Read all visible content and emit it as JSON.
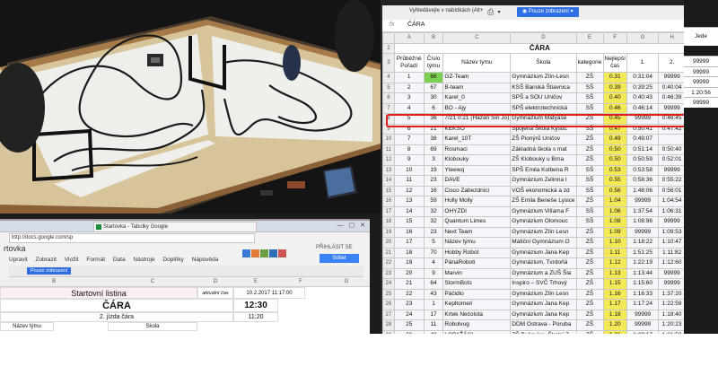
{
  "monitor": {
    "toolbar": {
      "label": "Vyhledávejte v nabídkách (Alt+",
      "view_button": "Pouze zobrazení",
      "icons": [
        "print-icon",
        "filter-icon"
      ]
    },
    "formula_bar": {
      "label": "fx",
      "value": "ČÁRA"
    },
    "column_headers": [
      "A",
      "B",
      "C",
      "D",
      "E",
      "F",
      "G",
      "H"
    ],
    "merged_title": "ČÁRA",
    "header_row": {
      "row": "3",
      "cells": [
        "Průběžné Pořadí",
        "Číslo týmu",
        "Název týmu",
        "Škola",
        "kategorie",
        "Nejlepší čas",
        "1.",
        "2."
      ]
    },
    "rows": [
      [
        "4",
        "1",
        "66",
        "GZ-Team",
        "Gymnázium Zlín-Lesn",
        "ZŠ",
        "0.31",
        "0:31:04",
        "99999"
      ],
      [
        "5",
        "2",
        "67",
        "B-team",
        "KSŠ Banská Štiavnica",
        "SŠ",
        "0.39",
        "0:39:25",
        "0:40:04"
      ],
      [
        "6",
        "3",
        "30",
        "Karel_0",
        "SPŠ a SOU Uničov",
        "SŠ",
        "0.40",
        "0:40:43",
        "0:46:39"
      ],
      [
        "7",
        "4",
        "6",
        "BO - Ajy",
        "SPŠ elektrotechnická",
        "SŠ",
        "0.46",
        "0:46:14",
        "99999"
      ],
      [
        "8",
        "5",
        "36",
        "7/21 0:21 (Hazan Sin Jo)",
        "Gymnázium Matyáše",
        "ZŠ",
        "0.45",
        "99999",
        "0:46:45"
      ],
      [
        "9",
        "6",
        "21",
        "KEKSO",
        "Spojená Škola Kysuc",
        "SŠ",
        "0.47",
        "0:50:41",
        "0:47:42"
      ],
      [
        "10",
        "7",
        "38",
        "Karel_10T",
        "ZŠ Pionýrů Uničov",
        "ZŠ",
        "0.49",
        "0:49:07",
        ""
      ],
      [
        "11",
        "8",
        "69",
        "Rosmaci",
        "Základná škola s mat",
        "ZŠ",
        "0.50",
        "0:51:14",
        "0:50:40"
      ],
      [
        "12",
        "9",
        "3",
        "Klobouky",
        "ZŠ Klobouky u Brna",
        "ZŠ",
        "0.50",
        "0:50:59",
        "0:52:01"
      ],
      [
        "13",
        "10",
        "19",
        "Yteewq",
        "SPŠ Emila Kolbena R",
        "SŠ",
        "0.53",
        "0:53:58",
        "99999"
      ],
      [
        "14",
        "11",
        "23",
        "DAVE",
        "Gymnázium Zelinna I",
        "SŠ",
        "0.55",
        "0:58:36",
        "0:55:22"
      ],
      [
        "15",
        "12",
        "16",
        "Cisco Zabezdnici",
        "VOŠ ekonomická a zd",
        "SŠ",
        "0.56",
        "1:48:06",
        "0:56:01"
      ],
      [
        "16",
        "13",
        "59",
        "Holly Molly",
        "ZŠ Emila Beneše Lysice",
        "ZŠ",
        "1.04",
        "99999",
        "1:04:54"
      ],
      [
        "17",
        "14",
        "32",
        "OHYZDI",
        "Gymnázium Vilíama F",
        "SŠ",
        "1.06",
        "1:37:54",
        "1:06:31"
      ],
      [
        "18",
        "15",
        "32",
        "Quantum Limes",
        "Gymnázium Olomouc",
        "SŠ",
        "1.08",
        "1:08:96",
        "99999"
      ],
      [
        "19",
        "16",
        "23",
        "Next Team",
        "Gymnázium Zlín Lesn",
        "ZŠ",
        "1.09",
        "99999",
        "1:09:53"
      ],
      [
        "20",
        "17",
        "5",
        "Název týmu",
        "Matiční Gymnázium O",
        "ZŠ",
        "1.10",
        "1:18:22",
        "1:10:47"
      ],
      [
        "21",
        "18",
        "70",
        "Hobby Robot",
        "Gymnázium Jana Kep",
        "ZŠ",
        "1.11",
        "1:51:25",
        "1:11:82"
      ],
      [
        "22",
        "19",
        "4",
        "PánaRoboti",
        "Gymnázium, Tvrdoňá",
        "ZŠ",
        "1.12",
        "1:22:19",
        "1:12:60"
      ],
      [
        "23",
        "20",
        "9",
        "Marvin",
        "Gymnázium a ZUŠ Šla",
        "ZŠ",
        "1.13",
        "1:13:44",
        "99999"
      ],
      [
        "24",
        "21",
        "64",
        "StormBots",
        "Inspiro – SVČ Trhový",
        "ZŠ",
        "1.15",
        "1:15:60",
        "99999"
      ],
      [
        "25",
        "22",
        "43",
        "Páčidlo",
        "Gymnázium Zlín Lesn",
        "ZŠ",
        "1.16",
        "1:16:33",
        "1:37:20"
      ],
      [
        "26",
        "23",
        "1",
        "Kepltomeri",
        "Gymnázium Jana Kep",
        "ZŠ",
        "1.17",
        "1:17:24",
        "1:22:59"
      ],
      [
        "27",
        "24",
        "17",
        "Krtek Nečolota",
        "Gymnázium Jana Kep",
        "ZŠ",
        "1.18",
        "99999",
        "1:18:40"
      ],
      [
        "28",
        "25",
        "11",
        "Robolvug",
        "DDM Ostrava - Poruba",
        "ZŠ",
        "1.20",
        "99999",
        "1:20:23"
      ],
      [
        "29",
        "26",
        "48",
        "LOPAŤÁCI",
        "ZŠ Bučovice, Školní 7",
        "ZŠ",
        "1.21",
        "1:39:17",
        "1:21:58"
      ],
      [
        "30",
        "27",
        "7",
        "Megatroni",
        "Gymnázium Velké Pa",
        "ZŠ",
        "1.24",
        "99999",
        "1:24:16"
      ],
      [
        "31",
        "28",
        "41",
        "Line Defenders",
        "Jiráskovo gymnázium",
        "SŠ",
        "1.30",
        "1:30:46",
        "1:30:48"
      ],
      [
        "32",
        "29",
        "4",
        "Čiernall s.r.o.",
        "Jiráskovo gymnázium",
        "ZŠ",
        "1.29",
        "1:29:63",
        "99999"
      ],
      [
        "33",
        "30",
        "2",
        "Rebelové",
        "ZŠ Bučovice, Školní 7",
        "ZŠ",
        "1.31",
        "99999",
        "1:42:44"
      ]
    ],
    "highlighted_row_index": 5,
    "green_cell_row": 0
  },
  "right_strip": {
    "header": "Jede",
    "values": [
      "99999",
      "99999",
      "99999",
      "1:20:56",
      "99999"
    ]
  },
  "laptop": {
    "browser_tab": "Startovka - Tabulky Google",
    "url": "http://docs.google.com/sp",
    "sheet_title": "rtovka",
    "menu": [
      "Upravit",
      "Zobrazit",
      "Vložit",
      "Formát",
      "Data",
      "Nástroje",
      "Doplňky",
      "Nápověda"
    ],
    "sign_in": "PŘIHLÁSIT SE",
    "share_button": "Sdílet",
    "view_button": "Pouze zobrazení",
    "columns": [
      "B",
      "C",
      "D",
      "E",
      "F",
      "G"
    ],
    "start_list_title": "Startovní listina",
    "current_time_label": "aktuální čas",
    "current_time_value": "10.2.2017 11:17:00",
    "cara_label": "ČÁRA",
    "cara_time": "12:30",
    "sub_label": "2. jízda čára",
    "sub_time": "11:20",
    "bottom_labels": [
      "Název týmu",
      "Škola"
    ]
  }
}
